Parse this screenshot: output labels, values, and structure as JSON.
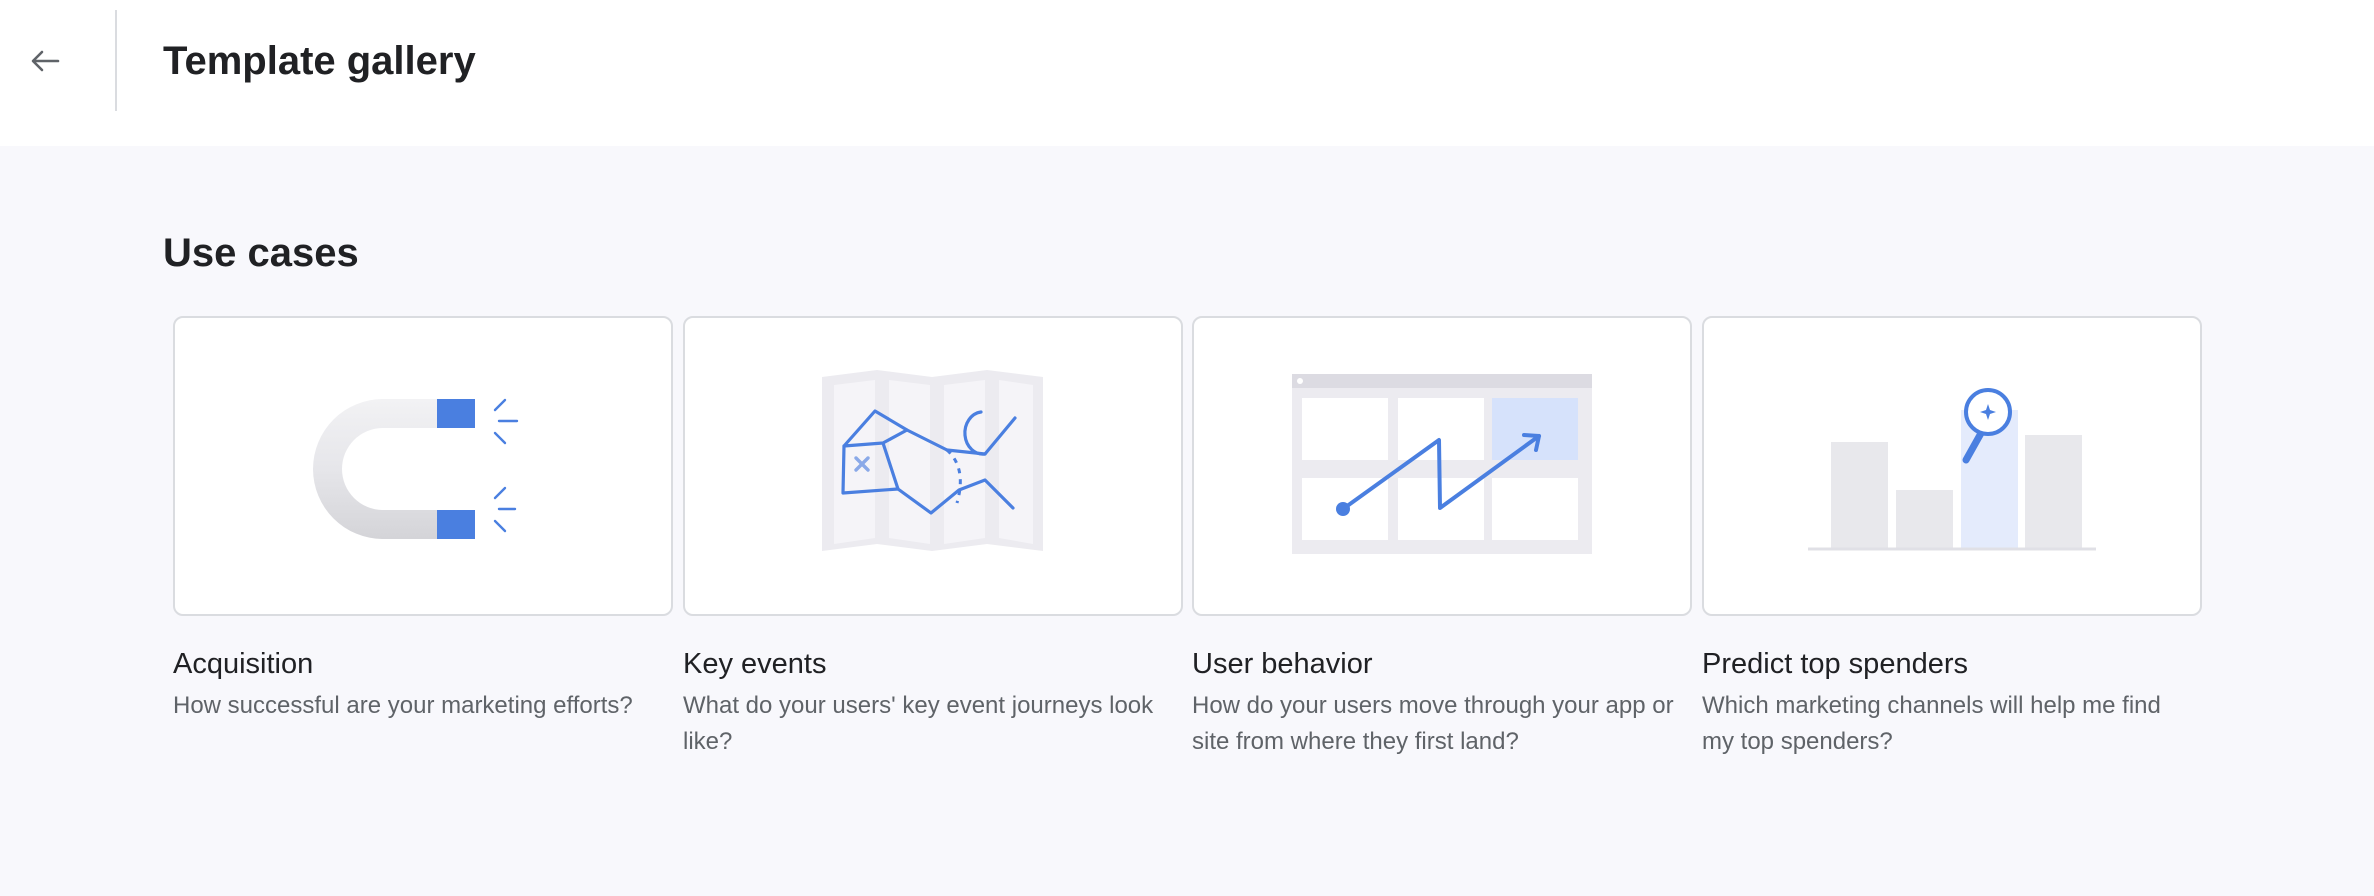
{
  "header": {
    "title": "Template gallery"
  },
  "section": {
    "title": "Use cases"
  },
  "cards": [
    {
      "title": "Acquisition",
      "description": "How successful are your marketing efforts?"
    },
    {
      "title": "Key events",
      "description": "What do your users' key event journeys look like?"
    },
    {
      "title": "User behavior",
      "description": "How do your users move through your app or site from where they first land?"
    },
    {
      "title": "Predict top spenders",
      "description": "Which marketing channels will help me find my top spenders?"
    }
  ],
  "colors": {
    "accent": "#4a7fe0",
    "accent_light": "#dbe5fb",
    "neutral_fill": "#e8e8ec",
    "border": "#dadce0"
  },
  "icons": {
    "back": "arrow-back-icon"
  }
}
